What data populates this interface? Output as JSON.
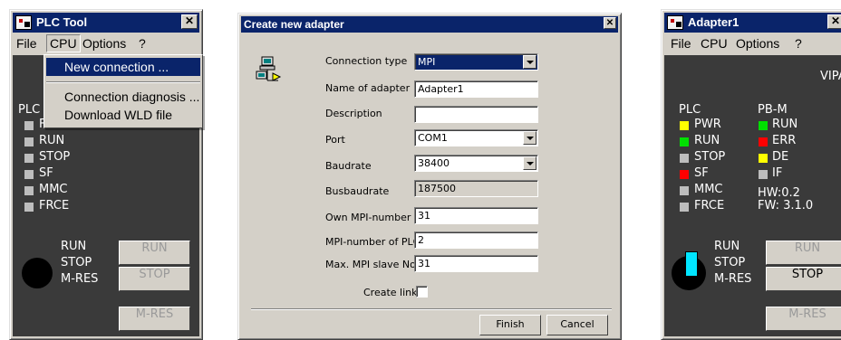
{
  "colors": {
    "titlebar": "#0a246a",
    "panel": "#3a3a3a",
    "led_yellow": "#ffff00",
    "led_green": "#00e000",
    "led_gray": "#bdbdbd",
    "led_red": "#ff0000",
    "switch_cyan": "#00e5ff"
  },
  "plc_tool": {
    "title": "PLC Tool",
    "close_glyph": "✕",
    "menu": [
      "File",
      "CPU",
      "Options",
      "?"
    ],
    "cpu_menu": {
      "items": [
        "New connection ...",
        "Connection diagnosis ...",
        "Download WLD file"
      ],
      "selected_index": 0
    },
    "plc_label_partial": "PLC",
    "leds": [
      "F",
      "RUN",
      "STOP",
      "SF",
      "MMC",
      "FRCE"
    ],
    "switch_labels": [
      "RUN",
      "STOP",
      "M-RES"
    ],
    "buttons": [
      "RUN",
      "STOP",
      "M-RES"
    ]
  },
  "dialog": {
    "title": "Create new adapter",
    "close_glyph": "✕",
    "icon": "network-computer-icon",
    "fields": [
      {
        "label": "Connection type",
        "value": "MPI",
        "kind": "dropdown"
      },
      {
        "label": "Name of adapter",
        "value": "Adapter1",
        "kind": "text"
      },
      {
        "label": "Description",
        "value": "",
        "kind": "text"
      },
      {
        "label": "Port",
        "value": "COM1",
        "kind": "dropdown"
      },
      {
        "label": "Baudrate",
        "value": "38400",
        "kind": "dropdown"
      },
      {
        "label": "Busbaudrate",
        "value": "187500",
        "kind": "readonly"
      },
      {
        "label": "Own MPI-number",
        "value": "31",
        "kind": "text"
      },
      {
        "label": "MPI-number of PLC",
        "value": "2",
        "kind": "text"
      },
      {
        "label": "Max. MPI slave No",
        "value": "31",
        "kind": "text"
      }
    ],
    "create_link_label": "Create link",
    "create_link_checked": false,
    "finish_label": "Finish",
    "cancel_label": "Cancel"
  },
  "adapter": {
    "title": "Adapter1",
    "close_glyph": "✕",
    "menu": [
      "File",
      "CPU",
      "Options",
      "?"
    ],
    "vendor_partial": "VIPA",
    "plc_header": "PLC",
    "plc_leds": [
      {
        "label": "PWR",
        "color": "yellow"
      },
      {
        "label": "RUN",
        "color": "green"
      },
      {
        "label": "STOP",
        "color": "gray"
      },
      {
        "label": "SF",
        "color": "red"
      },
      {
        "label": "MMC",
        "color": "gray"
      },
      {
        "label": "FRCE",
        "color": "gray"
      }
    ],
    "pbm_header": "PB-M",
    "pbm_leds": [
      {
        "label": "RUN",
        "color": "green"
      },
      {
        "label": "ERR",
        "color": "red"
      },
      {
        "label": "DE",
        "color": "yellow"
      },
      {
        "label": "IF",
        "color": "gray"
      }
    ],
    "hw_version": "HW:0.2",
    "fw_version": "FW: 3.1.0",
    "switch_labels": [
      "RUN",
      "STOP",
      "M-RES"
    ],
    "buttons": [
      {
        "label": "RUN",
        "enabled": false
      },
      {
        "label": "STOP",
        "enabled": true
      },
      {
        "label": "M-RES",
        "enabled": false
      }
    ]
  }
}
